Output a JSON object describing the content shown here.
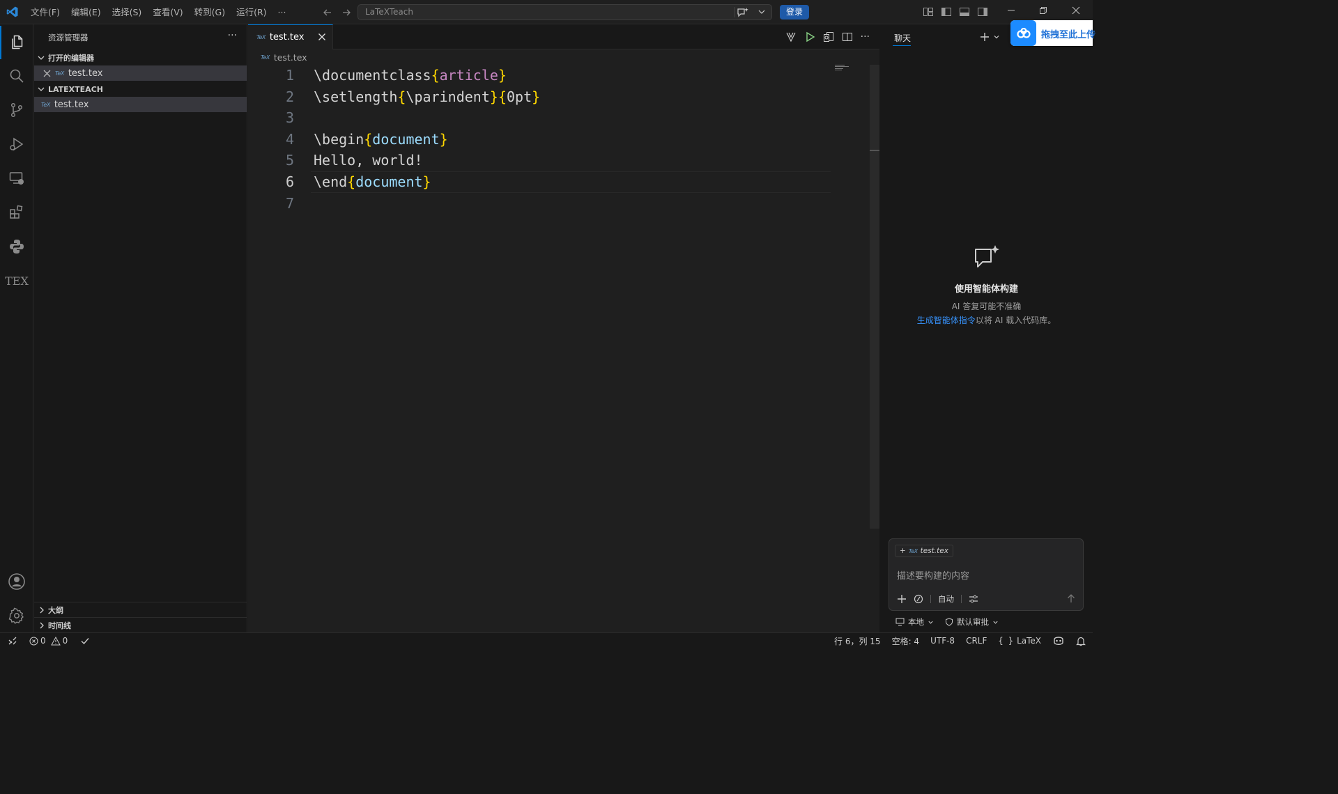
{
  "menu": [
    "文件(F)",
    "编辑(E)",
    "选择(S)",
    "查看(V)",
    "转到(G)",
    "运行(R)",
    "···"
  ],
  "search": {
    "text": "LaTeXTeach"
  },
  "login_label": "登录",
  "explorer": {
    "title": "资源管理器",
    "open_editors_title": "打开的编辑器",
    "open_editor_file": "test.tex",
    "workspace_title": "LATEXTEACH",
    "workspace_file": "test.tex",
    "outline_title": "大纲",
    "timeline_title": "时间线"
  },
  "tex_badge": "TeX",
  "tex_activity_label": "TEX",
  "tab": {
    "label": "test.tex"
  },
  "breadcrumb": "test.tex",
  "code_lines": [
    {
      "n": "1",
      "parts": [
        [
          "cmd",
          "\\documentclass"
        ],
        [
          "brk",
          "{"
        ],
        [
          "pk",
          "article"
        ],
        [
          "brk",
          "}"
        ]
      ]
    },
    {
      "n": "2",
      "parts": [
        [
          "cmd",
          "\\setlength"
        ],
        [
          "brk",
          "{"
        ],
        [
          "cmd",
          "\\parindent"
        ],
        [
          "brk",
          "}{"
        ],
        [
          "cmd",
          "0pt"
        ],
        [
          "brk",
          "}"
        ]
      ]
    },
    {
      "n": "3",
      "parts": []
    },
    {
      "n": "4",
      "parts": [
        [
          "cmd",
          "\\begin"
        ],
        [
          "brk",
          "{"
        ],
        [
          "doc",
          "document"
        ],
        [
          "brk",
          "}"
        ]
      ]
    },
    {
      "n": "5",
      "parts": [
        [
          "cmd",
          "Hello, world!"
        ]
      ]
    },
    {
      "n": "6",
      "parts": [
        [
          "cmd",
          "\\end"
        ],
        [
          "brk",
          "{"
        ],
        [
          "doc",
          "document"
        ],
        [
          "brk",
          "}"
        ]
      ]
    },
    {
      "n": "7",
      "parts": []
    }
  ],
  "chat": {
    "title": "聊天",
    "baidu_banner": "拖拽至此上传",
    "empty_heading": "使用智能体构建",
    "empty_sub1": "AI 答复可能不准确",
    "empty_link": "生成智能体指令",
    "empty_sub2_rest": "以将 AI 载入代码库。",
    "context_chip": "test.tex",
    "placeholder": "描述要构建的内容",
    "mode": "自动",
    "footer_local": "本地",
    "footer_approval": "默认审批"
  },
  "status": {
    "errors": "0",
    "warnings": "0",
    "position": "行 6，列 15",
    "spaces": "空格: 4",
    "encoding": "UTF-8",
    "eol": "CRLF",
    "language": "LaTeX"
  },
  "colors": {
    "accent": "#0078d4",
    "login_bg": "#1e5aa8",
    "link": "#3794ff"
  }
}
